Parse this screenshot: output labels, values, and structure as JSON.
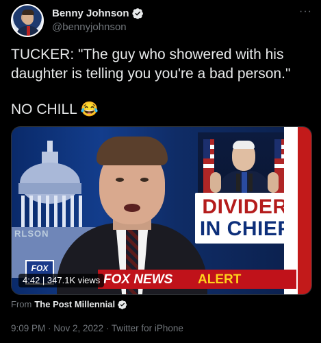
{
  "author": {
    "name": "Benny Johnson",
    "handle": "@bennyjohnson"
  },
  "more_menu": "···",
  "tweet": {
    "line1": "TUCKER: \"The guy who showered with his daughter is telling you you're a bad person.\"",
    "line2": "NO CHILL 😂"
  },
  "media": {
    "divider_line1": "DIVIDER",
    "divider_line2": "IN CHIEF",
    "background_text": "RLSON",
    "fox_logo": "FOX",
    "alert_brand": "FOX NEWS",
    "alert_word": "ALERT",
    "video_meta": "4:42 | 347.1K views"
  },
  "from": {
    "prefix": "From",
    "source": "The Post Millennial"
  },
  "timestamp": "9:09 PM · Nov 2, 2022 · Twitter for iPhone",
  "colors": {
    "background": "#000000",
    "text": "#e7e9ea",
    "muted": "#71767b",
    "verified": "#1d9bf0",
    "alert_red": "#c0121a",
    "alert_yellow": "#ffd21c"
  }
}
